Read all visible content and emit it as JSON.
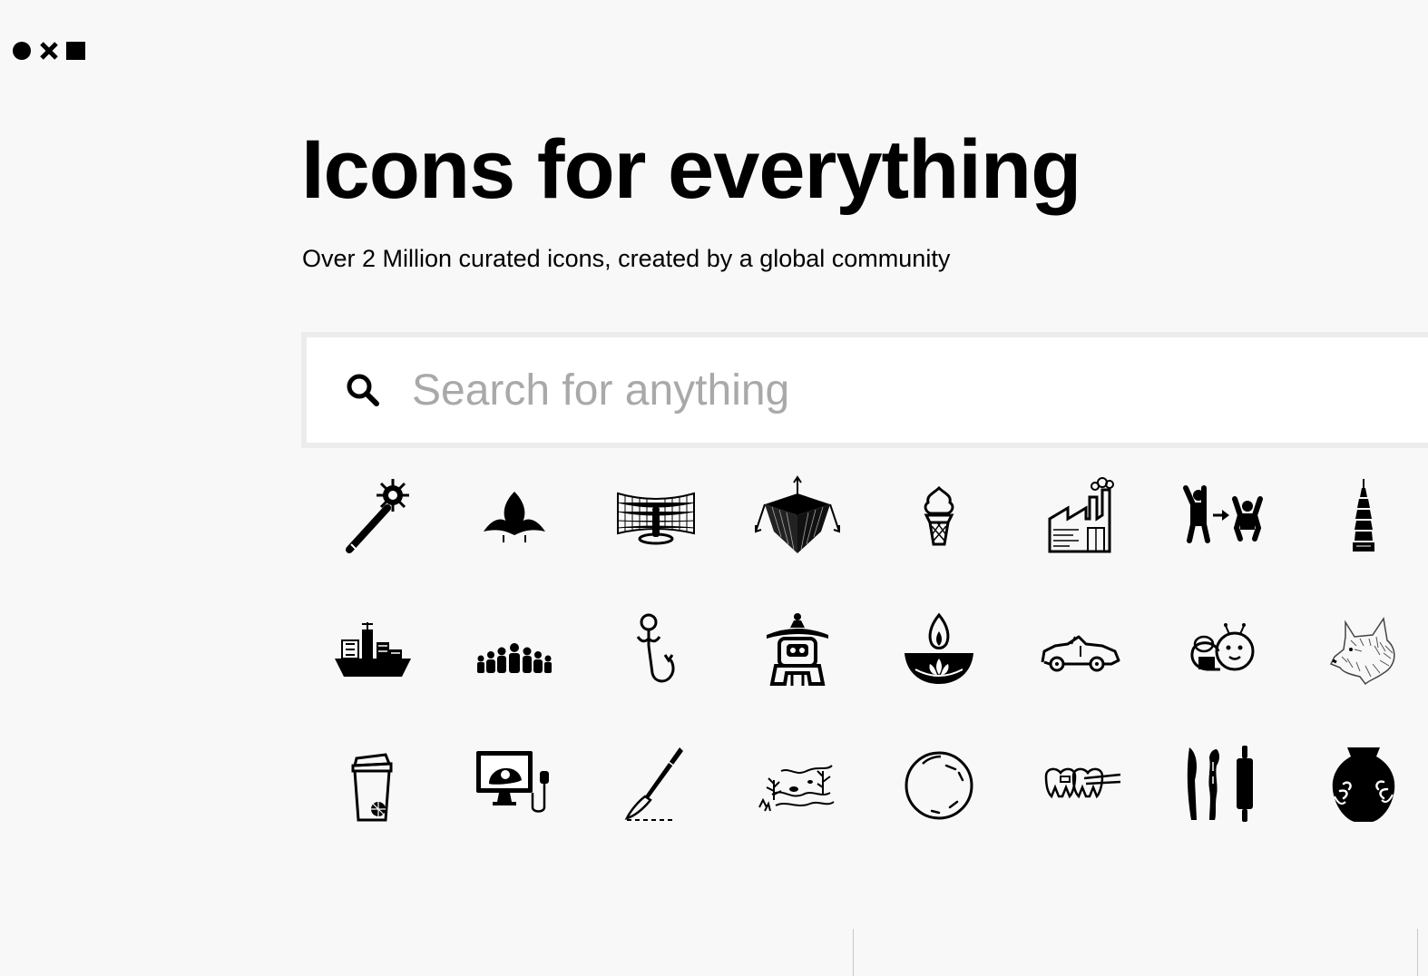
{
  "header": {
    "logo_icon": "circle-cross-square-logo"
  },
  "hero": {
    "title": "Icons for everything",
    "subtitle": "Over 2 Million curated icons, created by a global community"
  },
  "search": {
    "placeholder": "Search for anything",
    "value": "",
    "icon": "magnifier-icon"
  },
  "icons": [
    "mace-wand",
    "bird-leaf-shape",
    "vr-room-person",
    "cube-axes",
    "ice-cream-cone",
    "factory-building",
    "child-jump-transform",
    "taipei-tower",
    "cargo-ship",
    "crowd-people",
    "anchor-person-hook",
    "lantern-robot",
    "diya-lamp",
    "convertible-car",
    "bee-cartoon",
    "wolf-head",
    "shaker-bottle",
    "ultrasound-monitor",
    "scalpel",
    "swamp-landscape",
    "pearl-bubble",
    "dental-crowns",
    "sculpting-tools",
    "pottery-vase"
  ],
  "colors": {
    "background": "#f8f8f8",
    "search_border": "#ececec",
    "placeholder": "#a9a9a9",
    "icon": "#000000"
  }
}
